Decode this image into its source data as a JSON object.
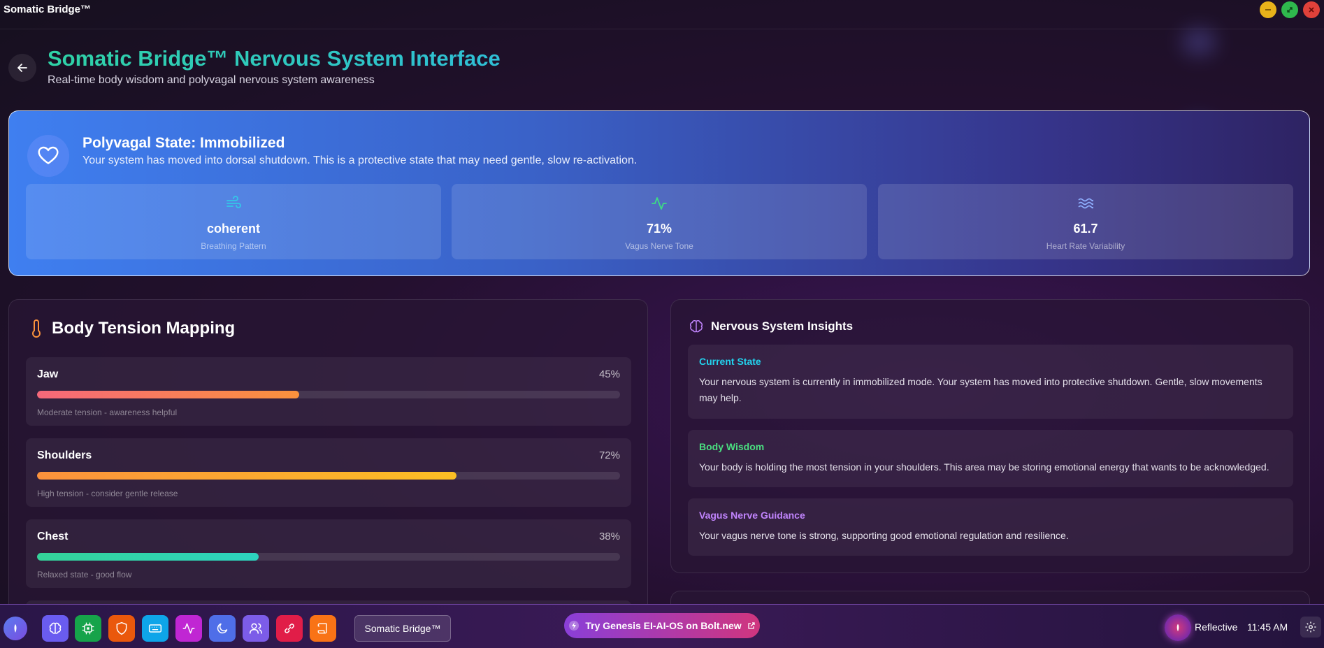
{
  "window": {
    "title": "Somatic Bridge™"
  },
  "header": {
    "title": "Somatic Bridge™ Nervous System Interface",
    "subtitle": "Real-time body wisdom and polyvagal nervous system awareness"
  },
  "state": {
    "title": "Polyvagal State: Immobilized",
    "description": "Your system has moved into dorsal shutdown. This is a protective state that may need gentle, slow re-activation.",
    "metrics": [
      {
        "value": "coherent",
        "label": "Breathing Pattern",
        "icon": "wind-icon",
        "color": "#33c7e8"
      },
      {
        "value": "71%",
        "label": "Vagus Nerve Tone",
        "icon": "activity-icon",
        "color": "#3ddc84"
      },
      {
        "value": "61.7",
        "label": "Heart Rate Variability",
        "icon": "waves-icon",
        "color": "#8fb0ff"
      }
    ]
  },
  "tension": {
    "title": "Body Tension Mapping",
    "items": [
      {
        "name": "Jaw",
        "percent": "45%",
        "level": 0.45,
        "note": "Moderate tension - awareness helpful",
        "colorFrom": "#f5687a",
        "colorTo": "#fb923c"
      },
      {
        "name": "Shoulders",
        "percent": "72%",
        "level": 0.72,
        "note": "High tension - consider gentle release",
        "colorFrom": "#fb923c",
        "colorTo": "#fbbf24"
      },
      {
        "name": "Chest",
        "percent": "38%",
        "level": 0.38,
        "note": "Relaxed state - good flow",
        "colorFrom": "#34d399",
        "colorTo": "#2dd4bf"
      }
    ]
  },
  "insights": {
    "title": "Nervous System Insights",
    "items": [
      {
        "title": "Current State",
        "color": "#22d3ee",
        "text": "Your nervous system is currently in immobilized mode. Your system has moved into protective shutdown. Gentle, slow movements may help."
      },
      {
        "title": "Body Wisdom",
        "color": "#4ade80",
        "text": "Your body is holding the most tension in your shoulders. This area may be storing emotional energy that wants to be acknowledged."
      },
      {
        "title": "Vagus Nerve Guidance",
        "color": "#c084fc",
        "text": "Your vagus nerve tone is strong, supporting good emotional regulation and resilience."
      }
    ]
  },
  "taskbar": {
    "active_app": "Somatic Bridge™",
    "promo": "Try Genesis EI-AI-OS on Bolt.new",
    "mode": "Reflective",
    "time": "11:45 AM",
    "apps": [
      {
        "icon": "brain-icon",
        "color": "#6a5cf0"
      },
      {
        "icon": "chip-icon",
        "color": "#16a34a"
      },
      {
        "icon": "shield-icon",
        "color": "#ea580c"
      },
      {
        "icon": "keyboard-icon",
        "color": "#0ea5e9"
      },
      {
        "icon": "activity-icon",
        "color": "#c026d3"
      },
      {
        "icon": "moon-icon",
        "color": "#4f6ee8"
      },
      {
        "icon": "users-icon",
        "color": "#7c5ce8"
      },
      {
        "icon": "link-icon",
        "color": "#e11d48"
      },
      {
        "icon": "scroll-icon",
        "color": "#f97316"
      }
    ]
  }
}
